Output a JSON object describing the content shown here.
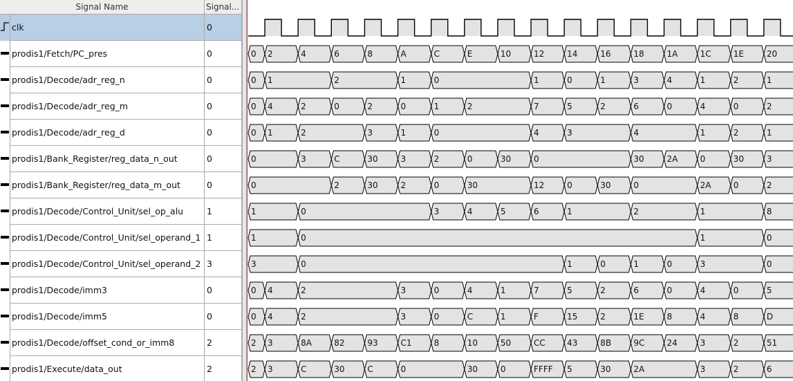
{
  "columns": {
    "name_header": "Signal Name",
    "value_header": "Signal..."
  },
  "colors": {
    "selected_row": "#b8cfe5",
    "cursor": "#d23232",
    "wave_fill": "#e3e3e3",
    "wave_line": "#000000"
  },
  "selected_signal": "clk",
  "clock": {
    "half_periods": 33,
    "initial_level": 0
  },
  "signals": [
    {
      "name": "clk",
      "value": "0",
      "kind": "clock",
      "icon": "clock-signal-icon"
    },
    {
      "name": "prodis1/Fetch/PC_pres",
      "value": "0",
      "kind": "bus",
      "icon": "bus-signal-icon",
      "segments": [
        [
          "0",
          0,
          1
        ],
        [
          "2",
          1,
          3
        ],
        [
          "4",
          3,
          5
        ],
        [
          "6",
          5,
          7
        ],
        [
          "8",
          7,
          9
        ],
        [
          "A",
          9,
          11
        ],
        [
          "C",
          11,
          13
        ],
        [
          "E",
          13,
          15
        ],
        [
          "10",
          15,
          17
        ],
        [
          "12",
          17,
          19
        ],
        [
          "14",
          19,
          21
        ],
        [
          "16",
          21,
          23
        ],
        [
          "18",
          23,
          25
        ],
        [
          "1A",
          25,
          27
        ],
        [
          "1C",
          27,
          29
        ],
        [
          "1E",
          29,
          31
        ],
        [
          "20",
          31,
          33
        ]
      ]
    },
    {
      "name": "prodis1/Decode/adr_reg_n",
      "value": "0",
      "kind": "bus",
      "icon": "bus-signal-icon",
      "segments": [
        [
          "0",
          0,
          1
        ],
        [
          "1",
          1,
          5
        ],
        [
          "2",
          5,
          9
        ],
        [
          "1",
          9,
          11
        ],
        [
          "0",
          11,
          17
        ],
        [
          "1",
          17,
          19
        ],
        [
          "0",
          19,
          21
        ],
        [
          "1",
          21,
          23
        ],
        [
          "3",
          23,
          25
        ],
        [
          "4",
          25,
          27
        ],
        [
          "1",
          27,
          29
        ],
        [
          "2",
          29,
          31
        ],
        [
          "1",
          31,
          33
        ]
      ]
    },
    {
      "name": "prodis1/Decode/adr_reg_m",
      "value": "0",
      "kind": "bus",
      "icon": "bus-signal-icon",
      "segments": [
        [
          "0",
          0,
          1
        ],
        [
          "4",
          1,
          3
        ],
        [
          "2",
          3,
          5
        ],
        [
          "0",
          5,
          7
        ],
        [
          "2",
          7,
          9
        ],
        [
          "0",
          9,
          11
        ],
        [
          "1",
          11,
          13
        ],
        [
          "2",
          13,
          17
        ],
        [
          "7",
          17,
          19
        ],
        [
          "5",
          19,
          21
        ],
        [
          "2",
          21,
          23
        ],
        [
          "6",
          23,
          25
        ],
        [
          "0",
          25,
          27
        ],
        [
          "4",
          27,
          29
        ],
        [
          "0",
          29,
          31
        ],
        [
          "2",
          31,
          33
        ]
      ]
    },
    {
      "name": "prodis1/Decode/adr_reg_d",
      "value": "0",
      "kind": "bus",
      "icon": "bus-signal-icon",
      "segments": [
        [
          "0",
          0,
          1
        ],
        [
          "1",
          1,
          3
        ],
        [
          "2",
          3,
          7
        ],
        [
          "3",
          7,
          9
        ],
        [
          "1",
          9,
          11
        ],
        [
          "0",
          11,
          17
        ],
        [
          "4",
          17,
          19
        ],
        [
          "3",
          19,
          23
        ],
        [
          "4",
          23,
          27
        ],
        [
          "1",
          27,
          29
        ],
        [
          "2",
          29,
          31
        ],
        [
          "1",
          31,
          33
        ]
      ]
    },
    {
      "name": "prodis1/Bank_Register/reg_data_n_out",
      "value": "0",
      "kind": "bus",
      "icon": "bus-signal-icon",
      "segments": [
        [
          "0",
          0,
          3
        ],
        [
          "3",
          3,
          5
        ],
        [
          "C",
          5,
          7
        ],
        [
          "30",
          7,
          9
        ],
        [
          "3",
          9,
          11
        ],
        [
          "2",
          11,
          13
        ],
        [
          "0",
          13,
          15
        ],
        [
          "30",
          15,
          17
        ],
        [
          "0",
          17,
          23
        ],
        [
          "30",
          23,
          25
        ],
        [
          "2A",
          25,
          27
        ],
        [
          "0",
          27,
          29
        ],
        [
          "30",
          29,
          31
        ],
        [
          "3",
          31,
          33
        ]
      ]
    },
    {
      "name": "prodis1/Bank_Register/reg_data_m_out",
      "value": "0",
      "kind": "bus",
      "icon": "bus-signal-icon",
      "segments": [
        [
          "0",
          0,
          5
        ],
        [
          "2",
          5,
          7
        ],
        [
          "30",
          7,
          9
        ],
        [
          "2",
          9,
          11
        ],
        [
          "0",
          11,
          13
        ],
        [
          "30",
          13,
          17
        ],
        [
          "12",
          17,
          19
        ],
        [
          "0",
          19,
          21
        ],
        [
          "30",
          21,
          23
        ],
        [
          "0",
          23,
          27
        ],
        [
          "2A",
          27,
          29
        ],
        [
          "0",
          29,
          31
        ],
        [
          "2",
          31,
          33
        ]
      ]
    },
    {
      "name": "prodis1/Decode/Control_Unit/sel_op_alu",
      "value": "1",
      "kind": "bus",
      "icon": "bus-signal-icon",
      "segments": [
        [
          "1",
          0,
          3
        ],
        [
          "0",
          3,
          11
        ],
        [
          "3",
          11,
          13
        ],
        [
          "4",
          13,
          15
        ],
        [
          "5",
          15,
          17
        ],
        [
          "6",
          17,
          19
        ],
        [
          "1",
          19,
          23
        ],
        [
          "2",
          23,
          27
        ],
        [
          "1",
          27,
          31
        ],
        [
          "8",
          31,
          33
        ]
      ]
    },
    {
      "name": "prodis1/Decode/Control_Unit/sel_operand_1",
      "value": "1",
      "kind": "bus",
      "icon": "bus-signal-icon",
      "segments": [
        [
          "1",
          0,
          3
        ],
        [
          "0",
          3,
          27
        ],
        [
          "1",
          27,
          31
        ],
        [
          "0",
          31,
          33
        ]
      ]
    },
    {
      "name": "prodis1/Decode/Control_Unit/sel_operand_2",
      "value": "3",
      "kind": "bus",
      "icon": "bus-signal-icon",
      "segments": [
        [
          "3",
          0,
          3
        ],
        [
          "0",
          3,
          19
        ],
        [
          "1",
          19,
          21
        ],
        [
          "0",
          21,
          23
        ],
        [
          "1",
          23,
          25
        ],
        [
          "0",
          25,
          27
        ],
        [
          "3",
          27,
          31
        ],
        [
          "0",
          31,
          33
        ]
      ]
    },
    {
      "name": "prodis1/Decode/imm3",
      "value": "0",
      "kind": "bus",
      "icon": "bus-signal-icon",
      "segments": [
        [
          "0",
          0,
          1
        ],
        [
          "4",
          1,
          3
        ],
        [
          "2",
          3,
          9
        ],
        [
          "3",
          9,
          11
        ],
        [
          "0",
          11,
          13
        ],
        [
          "4",
          13,
          15
        ],
        [
          "1",
          15,
          17
        ],
        [
          "7",
          17,
          19
        ],
        [
          "5",
          19,
          21
        ],
        [
          "2",
          21,
          23
        ],
        [
          "6",
          23,
          25
        ],
        [
          "0",
          25,
          27
        ],
        [
          "4",
          27,
          29
        ],
        [
          "0",
          29,
          31
        ],
        [
          "5",
          31,
          33
        ]
      ]
    },
    {
      "name": "prodis1/Decode/imm5",
      "value": "0",
      "kind": "bus",
      "icon": "bus-signal-icon",
      "segments": [
        [
          "0",
          0,
          1
        ],
        [
          "4",
          1,
          3
        ],
        [
          "2",
          3,
          9
        ],
        [
          "3",
          9,
          11
        ],
        [
          "0",
          11,
          13
        ],
        [
          "C",
          13,
          15
        ],
        [
          "1",
          15,
          17
        ],
        [
          "F",
          17,
          19
        ],
        [
          "15",
          19,
          21
        ],
        [
          "2",
          21,
          23
        ],
        [
          "1E",
          23,
          25
        ],
        [
          "8",
          25,
          27
        ],
        [
          "4",
          27,
          29
        ],
        [
          "8",
          29,
          31
        ],
        [
          "D",
          31,
          33
        ]
      ]
    },
    {
      "name": "prodis1/Decode/offset_cond_or_imm8",
      "value": "2",
      "kind": "bus",
      "icon": "bus-signal-icon",
      "segments": [
        [
          "2",
          0,
          1
        ],
        [
          "3",
          1,
          3
        ],
        [
          "8A",
          3,
          5
        ],
        [
          "82",
          5,
          7
        ],
        [
          "93",
          7,
          9
        ],
        [
          "C1",
          9,
          11
        ],
        [
          "8",
          11,
          13
        ],
        [
          "10",
          13,
          15
        ],
        [
          "50",
          15,
          17
        ],
        [
          "CC",
          17,
          19
        ],
        [
          "43",
          19,
          21
        ],
        [
          "8B",
          21,
          23
        ],
        [
          "9C",
          23,
          25
        ],
        [
          "24",
          25,
          27
        ],
        [
          "3",
          27,
          29
        ],
        [
          "2",
          29,
          31
        ],
        [
          "51",
          31,
          33
        ]
      ]
    },
    {
      "name": "prodis1/Execute/data_out",
      "value": "2",
      "kind": "bus",
      "icon": "bus-signal-icon",
      "segments": [
        [
          "2",
          0,
          1
        ],
        [
          "3",
          1,
          3
        ],
        [
          "C",
          3,
          5
        ],
        [
          "30",
          5,
          7
        ],
        [
          "C",
          7,
          9
        ],
        [
          "0",
          9,
          13
        ],
        [
          "30",
          13,
          15
        ],
        [
          "0",
          15,
          17
        ],
        [
          "FFFF",
          17,
          19
        ],
        [
          "5",
          19,
          21
        ],
        [
          "30",
          21,
          23
        ],
        [
          "2A",
          23,
          27
        ],
        [
          "3",
          27,
          29
        ],
        [
          "2",
          29,
          31
        ],
        [
          "6",
          31,
          33
        ]
      ]
    }
  ]
}
